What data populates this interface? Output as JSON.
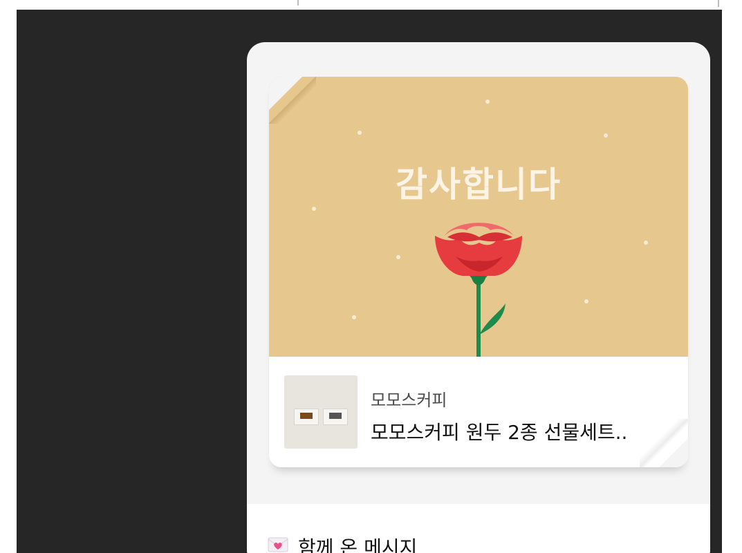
{
  "banner": {
    "title": "감사합니다",
    "background": "#e6c78e",
    "flower_color": "#e63b3f",
    "stem_color": "#1e8a4c"
  },
  "product": {
    "brand": "모모스커피",
    "name": "모모스커피 원두 2종 선물세트.."
  },
  "message_section": {
    "icon": "heart-envelope-icon",
    "title": "함께 온 메시지"
  }
}
